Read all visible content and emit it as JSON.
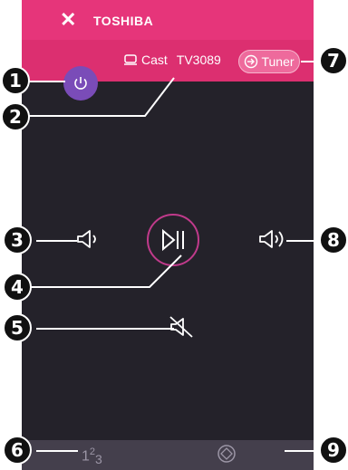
{
  "header": {
    "close_glyph": "✕",
    "brand": "TOSHIBA"
  },
  "device": {
    "cast_label": "Cast",
    "name": "TV3089"
  },
  "tuner_button": {
    "label": "Tuner"
  },
  "bottom_bar": {
    "numpad_label_1": "1",
    "numpad_label_2": "2",
    "numpad_label_3": "3"
  },
  "callouts": [
    "1",
    "2",
    "3",
    "4",
    "5",
    "6",
    "7",
    "8",
    "9"
  ],
  "colors": {
    "header_pink": "#e6357a",
    "accent_purple": "#7a4cb8",
    "background": "#24222a",
    "bottom_bar": "#443f4c"
  },
  "icons": {
    "close": "close-icon",
    "power": "power-icon",
    "cast": "cast-icon",
    "input": "input-icon",
    "volume_down": "volume-down-icon",
    "play_pause": "play-pause-icon",
    "volume_up": "volume-up-icon",
    "mute": "mute-icon",
    "dpad": "dpad-icon"
  }
}
